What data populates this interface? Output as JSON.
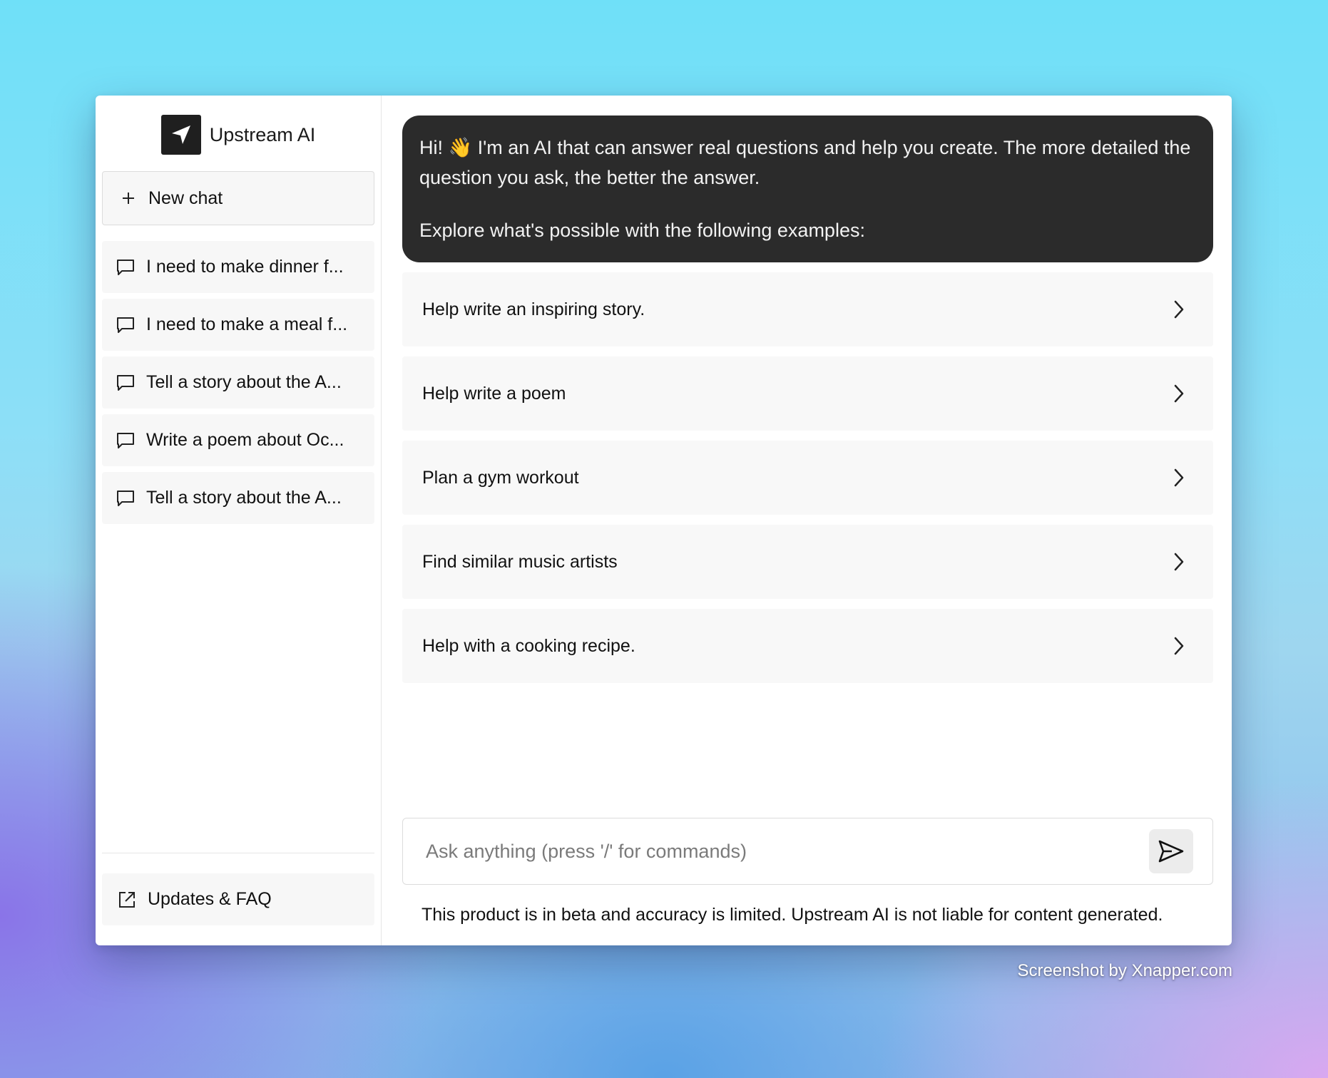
{
  "app": {
    "name": "Upstream AI",
    "logo_icon": "navigation-arrow-icon"
  },
  "sidebar": {
    "new_chat_label": "New chat",
    "history": [
      {
        "label": "I need to make dinner f..."
      },
      {
        "label": "I need to make a meal f..."
      },
      {
        "label": "Tell a story about the A..."
      },
      {
        "label": "Write a poem about Oc..."
      },
      {
        "label": "Tell a story about the A..."
      }
    ],
    "footer_link": "Updates & FAQ"
  },
  "intro": {
    "line1": "Hi! 👋 I'm an AI that can answer real questions and help you create. The more detailed the question you ask, the better the answer.",
    "line2": "Explore what's possible with the following examples:"
  },
  "examples": [
    {
      "label": "Help write an inspiring story."
    },
    {
      "label": "Help write a poem"
    },
    {
      "label": "Plan a gym workout"
    },
    {
      "label": "Find similar music artists"
    },
    {
      "label": "Help with a cooking recipe."
    }
  ],
  "composer": {
    "placeholder": "Ask anything (press '/' for commands)"
  },
  "disclaimer": "This product is in beta and accuracy is limited. Upstream AI is not liable for content generated.",
  "watermark": "Screenshot by Xnapper.com",
  "colors": {
    "intro_bg": "#2b2b2b",
    "item_bg": "#f7f7f7"
  }
}
